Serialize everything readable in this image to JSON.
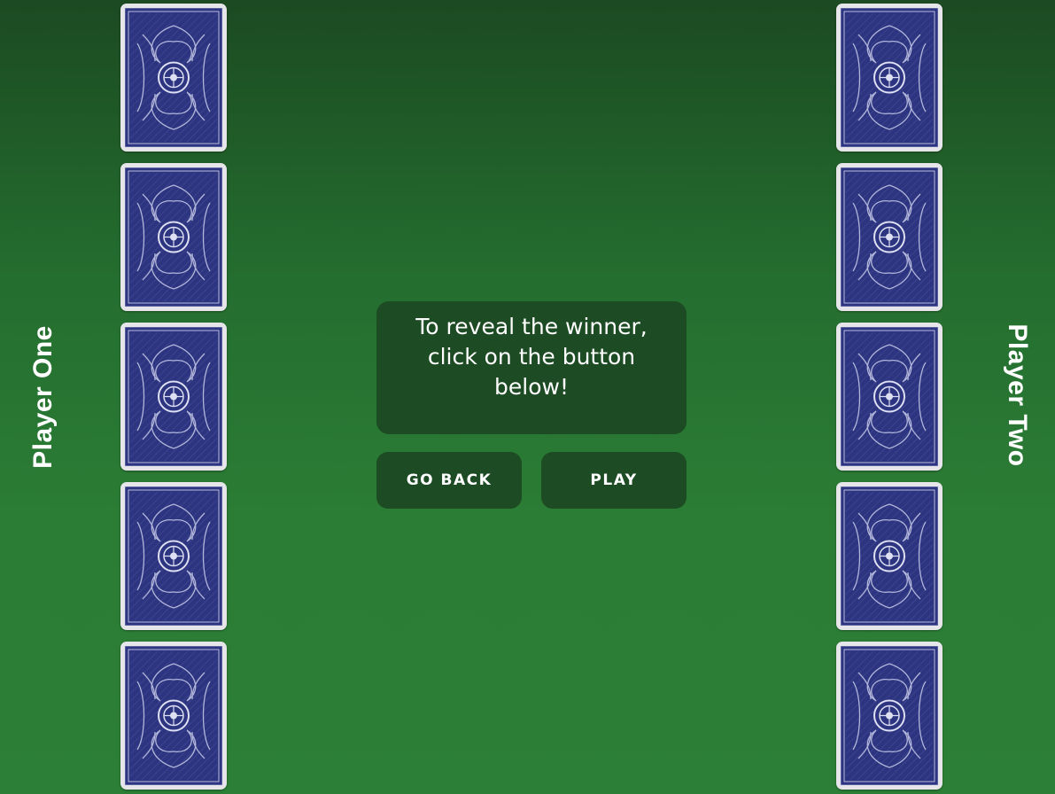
{
  "players": {
    "one": "Player One",
    "two": "Player Two"
  },
  "message": "To reveal the winner, click on the button below!",
  "buttons": {
    "go_back": "GO BACK",
    "play": "PLAY"
  },
  "cards": {
    "player_one_count": 5,
    "player_two_count": 5,
    "back_icon": "card-back-pattern-icon",
    "back_color": "#2d3480",
    "border_color": "#e6e6ea"
  },
  "colors": {
    "table_top": "#1c4a22",
    "table_bottom": "#2c7f36",
    "panel": "#1d4b23",
    "text": "#ffffff"
  }
}
